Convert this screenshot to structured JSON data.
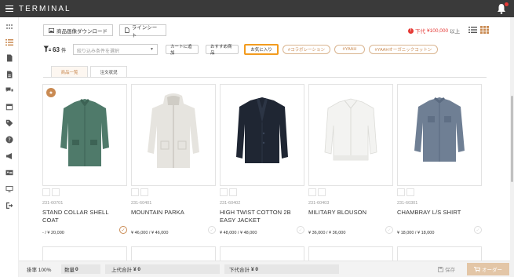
{
  "app": {
    "brand": "TERMINAL"
  },
  "toolbar": {
    "download_label": "商品画像ダウンロード",
    "linesheet_label": "ラインシート",
    "price_note_label": "下代",
    "price_note_amount": "¥100,000",
    "price_note_suffix": "以上"
  },
  "filter": {
    "count": "63",
    "count_unit": "件",
    "select_placeholder": "絞り込み条件を選択",
    "chips": {
      "cart": "カートに追加",
      "recommended": "おすすめ商品",
      "favorite": "お気に入り",
      "tag_collab": "#コラボレーション",
      "tag_yaah": "#YAAH",
      "tag_organic": "#YAAHオーガニックコットン"
    }
  },
  "tabs": {
    "products": "商品一覧",
    "orders": "注文状況"
  },
  "products": [
    {
      "code": "231-60701",
      "name": "STAND COLLAR SHELL COAT",
      "price": "- / ¥ 20,000"
    },
    {
      "code": "231-60401",
      "name": "MOUNTAIN PARKA",
      "price": "¥ 46,000 / ¥ 46,000"
    },
    {
      "code": "231-60402",
      "name": "HIGH TWIST COTTON 2B EASY JACKET",
      "price": "¥ 48,000 / ¥ 48,000"
    },
    {
      "code": "231-60403",
      "name": "MILITARY BLOUSON",
      "price": "¥ 36,000 / ¥ 36,000"
    },
    {
      "code": "231-60301",
      "name": "CHAMBRAY L/S SHIRT",
      "price": "¥ 18,000 / ¥ 18,000"
    }
  ],
  "footer": {
    "rate_label": "掛率 100%",
    "qty_label": "数量",
    "qty_value": "0",
    "upper_label": "上代合計",
    "upper_value": "¥ 0",
    "lower_label": "下代合計",
    "lower_value": "¥ 0",
    "save_label": "保存",
    "order_label": "オーダー"
  },
  "colors": {
    "accent": "#f29b1e",
    "brand_tan": "#c98a52",
    "alert": "#e53935",
    "topbar": "#3a3a3a"
  }
}
